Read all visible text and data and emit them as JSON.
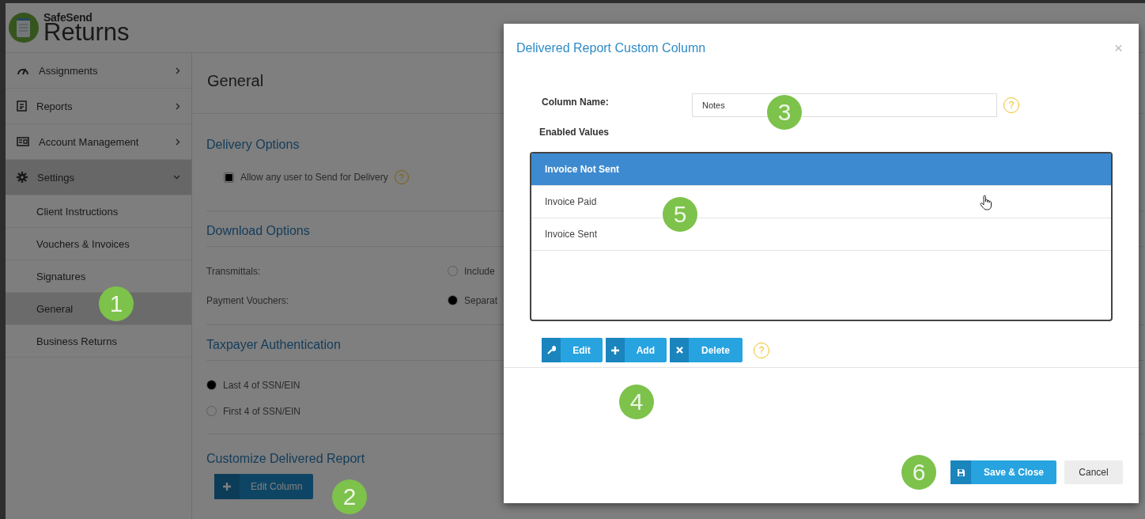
{
  "logo": {
    "brand_small": "SafeSend",
    "brand_large": "Returns"
  },
  "sidebar": {
    "items": [
      {
        "label": "Assignments",
        "selected": false,
        "expanded": false
      },
      {
        "label": "Reports",
        "selected": false,
        "expanded": false
      },
      {
        "label": "Account Management",
        "selected": false,
        "expanded": false
      },
      {
        "label": "Settings",
        "selected": true,
        "expanded": true,
        "children": [
          {
            "label": "Client Instructions",
            "selected": false
          },
          {
            "label": "Vouchers & Invoices",
            "selected": false
          },
          {
            "label": "Signatures",
            "selected": false
          },
          {
            "label": "General",
            "selected": true
          },
          {
            "label": "Business Returns",
            "selected": false
          }
        ]
      }
    ]
  },
  "main": {
    "title": "General",
    "sections": [
      {
        "heading": "Delivery Options",
        "kind": "checkbox",
        "options": [
          {
            "label": "Allow any user to Send for Delivery",
            "checked": true,
            "help": "?"
          }
        ]
      },
      {
        "heading": "Download Options",
        "kind": "radio_rows",
        "rows": [
          {
            "label": "Transmittals:",
            "option": {
              "label": "Include",
              "selected": false
            }
          },
          {
            "label": "Payment Vouchers:",
            "option": {
              "label": "Separat",
              "selected": true
            }
          }
        ]
      },
      {
        "heading": "Taxpayer Authentication",
        "kind": "radio",
        "options": [
          {
            "label": "Last 4 of SSN/EIN",
            "selected": true
          },
          {
            "label": "First 4 of SSN/EIN",
            "selected": false
          }
        ]
      },
      {
        "heading": "Customize Delivered Report",
        "kind": "button",
        "button": "Edit Column"
      }
    ]
  },
  "modal": {
    "title": "Delivered Report Custom Column",
    "close": "×",
    "column_name": {
      "label": "Column Name:",
      "value": "Notes",
      "help": "?"
    },
    "enabled_values": {
      "label": "Enabled Values",
      "items": [
        {
          "label": "Invoice Not Sent",
          "selected": true
        },
        {
          "label": "Invoice Paid",
          "selected": false
        },
        {
          "label": "Invoice Sent",
          "selected": false
        }
      ]
    },
    "actions": [
      "Edit",
      "Add",
      "Delete"
    ],
    "actions_help": "?",
    "footer": [
      {
        "label": "Save & Close",
        "kind": "primary"
      },
      {
        "label": "Cancel",
        "kind": "default"
      }
    ]
  },
  "markers": [
    "1",
    "2",
    "3",
    "4",
    "5",
    "6"
  ]
}
